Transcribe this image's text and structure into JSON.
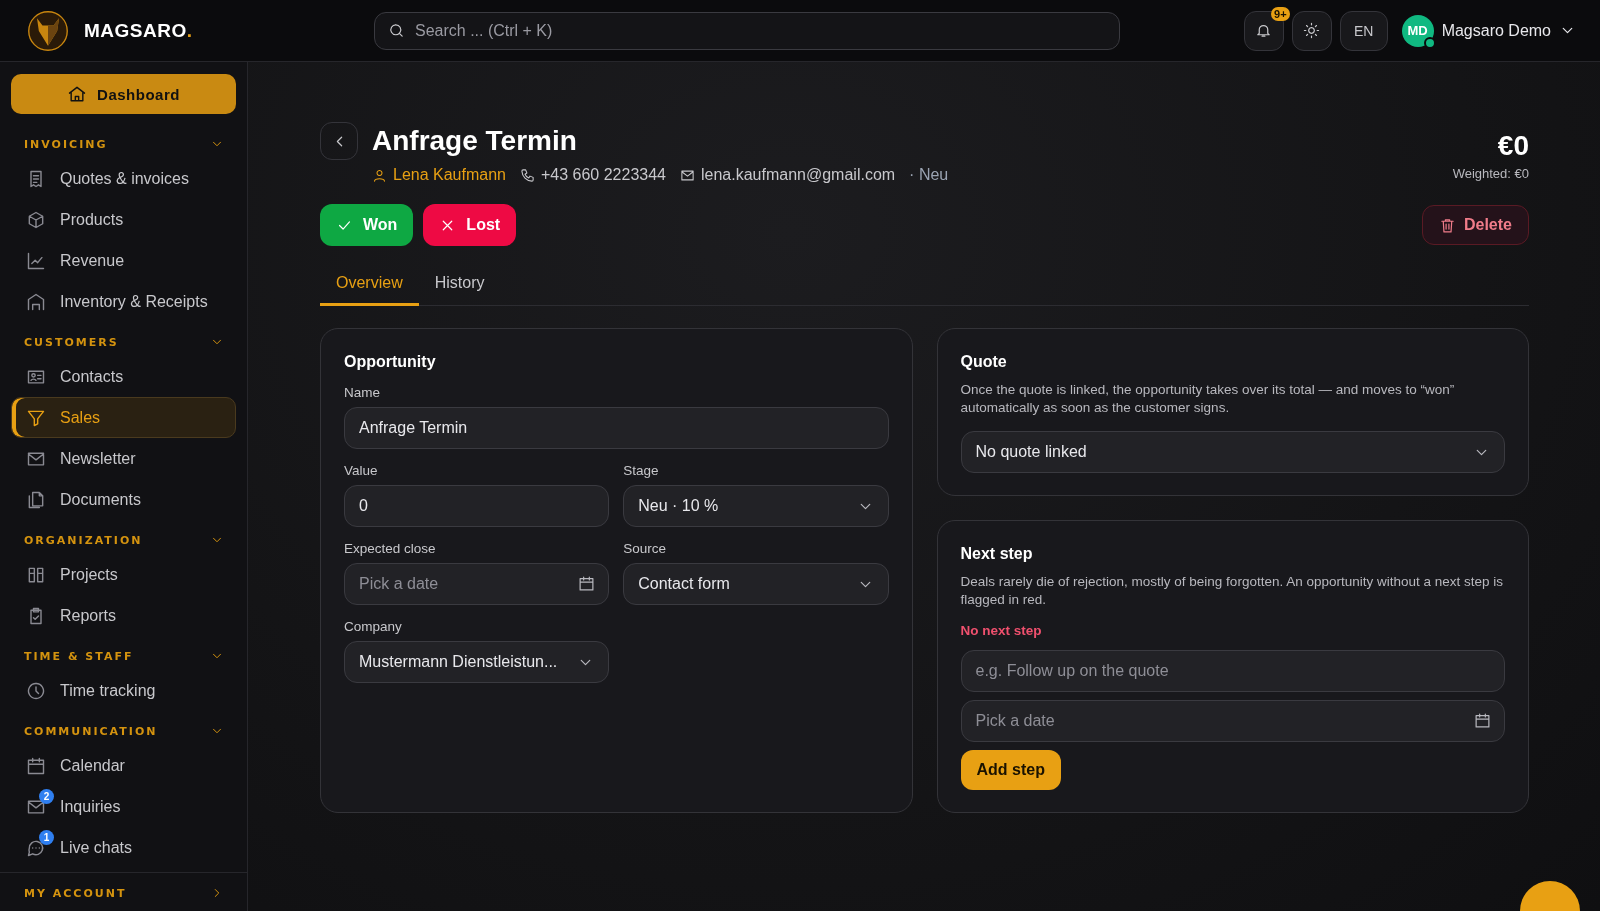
{
  "header": {
    "brand": "MAGSARO",
    "brand_mark": ".",
    "search": {
      "placeholder": "Search ... (Ctrl + K)"
    },
    "notifications": {
      "badge": "9+"
    },
    "language": "EN",
    "user": {
      "initials": "MD",
      "name": "Magsaro Demo",
      "online": true
    }
  },
  "sidebar": {
    "primary": {
      "label": "Dashboard"
    },
    "sections": [
      {
        "title": "INVOICING",
        "expanded": true,
        "items": [
          {
            "label": "Quotes & invoices",
            "selected": false
          },
          {
            "label": "Products",
            "selected": false
          },
          {
            "label": "Revenue",
            "selected": false
          },
          {
            "label": "Inventory & Receipts",
            "selected": false
          }
        ]
      },
      {
        "title": "CUSTOMERS",
        "expanded": true,
        "items": [
          {
            "label": "Contacts",
            "selected": false
          },
          {
            "label": "Sales",
            "selected": true
          },
          {
            "label": "Newsletter",
            "selected": false
          },
          {
            "label": "Documents",
            "selected": false
          }
        ]
      },
      {
        "title": "ORGANIZATION",
        "expanded": true,
        "items": [
          {
            "label": "Projects",
            "selected": false
          },
          {
            "label": "Reports",
            "selected": false
          }
        ]
      },
      {
        "title": "TIME & STAFF",
        "expanded": true,
        "items": [
          {
            "label": "Time tracking",
            "selected": false
          }
        ]
      },
      {
        "title": "COMMUNICATION",
        "expanded": true,
        "items": [
          {
            "label": "Calendar",
            "selected": false
          },
          {
            "label": "Inquiries",
            "selected": false,
            "badge": "2"
          },
          {
            "label": "Live chats",
            "selected": false,
            "badge": "1"
          }
        ]
      },
      {
        "title": "MY ACCOUNT",
        "expanded": false
      }
    ]
  },
  "deal": {
    "title": "Anfrage Termin",
    "contact": "Lena Kaufmann",
    "phone": "+43 660 2223344",
    "email": "lena.kaufmann@gmail.com",
    "stage": "· Neu",
    "amount": "€0",
    "weighted": "Weighted: €0"
  },
  "actions": [
    {
      "label": "Won",
      "kind": "won"
    },
    {
      "label": "Lost",
      "kind": "lost"
    }
  ],
  "delete": {
    "label": "Delete"
  },
  "tabs": [
    {
      "label": "Overview",
      "selected": true
    },
    {
      "label": "History",
      "selected": false
    }
  ],
  "opportunity": {
    "title": "Opportunity",
    "name": {
      "label": "Name",
      "value": "Anfrage Termin"
    },
    "value": {
      "label": "Value",
      "value": "0"
    },
    "stage": {
      "label": "Stage",
      "value": "Neu · 10 %"
    },
    "expected_close": {
      "label": "Expected close",
      "placeholder": "Pick a date"
    },
    "source": {
      "label": "Source",
      "value": "Contact form"
    },
    "company": {
      "label": "Company",
      "value": "Mustermann Dienstleistun..."
    }
  },
  "quote": {
    "title": "Quote",
    "text": "Once the quote is linked, the opportunity takes over its total — and moves to “won” automatically as soon as the customer signs.",
    "select": "No quote linked"
  },
  "next_step": {
    "title": "Next step",
    "text": "Deals rarely die of rejection, mostly of being forgotten. An opportunity without a next step is flagged in red.",
    "warning": "No next step",
    "step": {
      "placeholder": "e.g. Follow up on the quote"
    },
    "date": {
      "placeholder": "Pick a date"
    },
    "button": "Add step"
  }
}
